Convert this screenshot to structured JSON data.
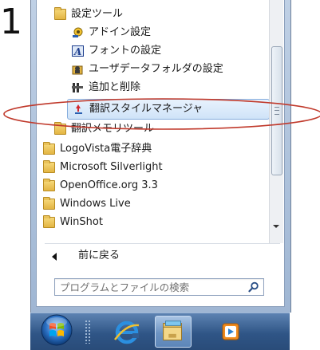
{
  "step_number": "1",
  "start_menu": {
    "programs": [
      {
        "label": "設定ツール",
        "icon": "folder-icon",
        "highlighted": false
      },
      {
        "label": "アドイン設定",
        "icon": "addin-settings-icon",
        "highlighted": false
      },
      {
        "label": "フォントの設定",
        "icon": "font-settings-icon",
        "highlighted": false
      },
      {
        "label": "ユーザデータフォルダの設定",
        "icon": "user-data-folder-icon",
        "highlighted": false
      },
      {
        "label": "追加と削除",
        "icon": "add-remove-icon",
        "highlighted": false
      },
      {
        "label": "翻訳スタイルマネージャ",
        "icon": "translation-style-manager-icon",
        "highlighted": true
      },
      {
        "label": "翻訳メモリツール",
        "icon": "folder-icon",
        "highlighted": false
      },
      {
        "label": "LogoVista電子辞典",
        "icon": "folder-icon",
        "highlighted": false
      },
      {
        "label": "Microsoft Silverlight",
        "icon": "folder-icon",
        "highlighted": false
      },
      {
        "label": "OpenOffice.org 3.3",
        "icon": "folder-icon",
        "highlighted": false
      },
      {
        "label": "Windows Live",
        "icon": "folder-icon",
        "highlighted": false
      },
      {
        "label": "WinShot",
        "icon": "folder-icon",
        "highlighted": false
      }
    ],
    "back_label": "前に戻る",
    "search": {
      "placeholder": "プログラムとファイルの検索"
    }
  },
  "taskbar": {
    "buttons": [
      {
        "name": "internet-explorer",
        "icon": "internet-explorer-icon"
      },
      {
        "name": "windows-explorer",
        "icon": "folder-library-icon"
      },
      {
        "name": "media-player",
        "icon": "media-player-icon"
      }
    ]
  },
  "annotation": {
    "color": "#c0392b"
  }
}
